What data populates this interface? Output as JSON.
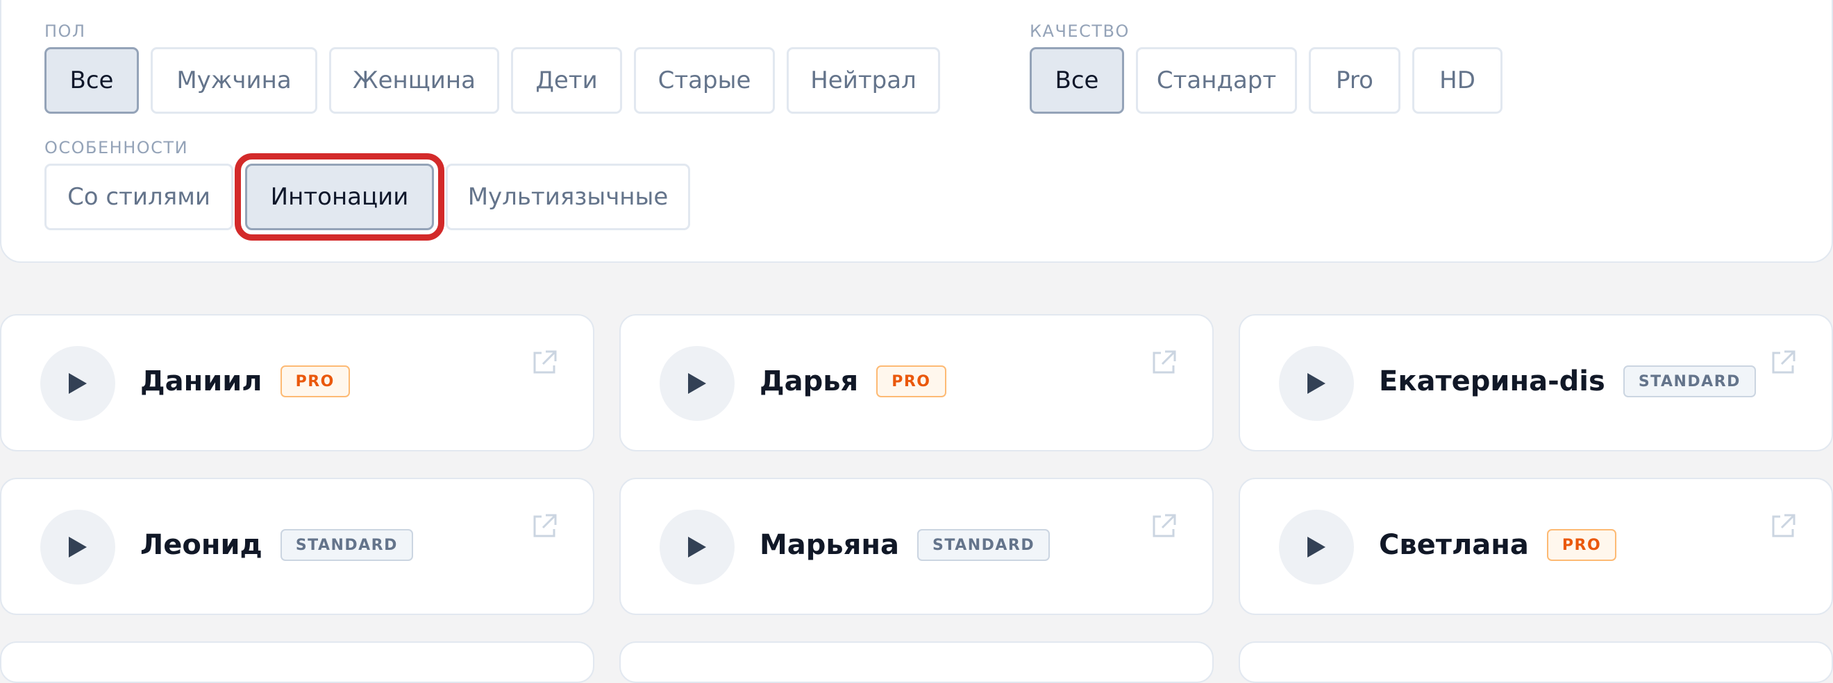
{
  "filters": {
    "gender": {
      "label": "ПОЛ",
      "options": [
        "Все",
        "Мужчина",
        "Женщина",
        "Дети",
        "Старые",
        "Нейтрал"
      ],
      "selected": "Все"
    },
    "quality": {
      "label": "КАЧЕСТВО",
      "options": [
        "Все",
        "Стандарт",
        "Pro",
        "HD"
      ],
      "selected": "Все"
    },
    "features": {
      "label": "ОСОБЕННОСТИ",
      "options": [
        "Со стилями",
        "Интонации",
        "Мультиязычные"
      ],
      "selected": "Интонации"
    }
  },
  "voices": [
    {
      "name": "Даниил",
      "badge": "PRO"
    },
    {
      "name": "Дарья",
      "badge": "PRO"
    },
    {
      "name": "Екатерина-dis",
      "badge": "STANDARD"
    },
    {
      "name": "Леонид",
      "badge": "STANDARD"
    },
    {
      "name": "Марьяна",
      "badge": "STANDARD"
    },
    {
      "name": "Светлана",
      "badge": "PRO"
    }
  ],
  "colors": {
    "highlight": "#d32a2a",
    "pro_badge": "#ea580c",
    "standard_badge": "#64748b",
    "active_chip_bg": "#e2e8f0"
  },
  "icons": {
    "play": "play-icon",
    "external": "external-link-icon"
  }
}
